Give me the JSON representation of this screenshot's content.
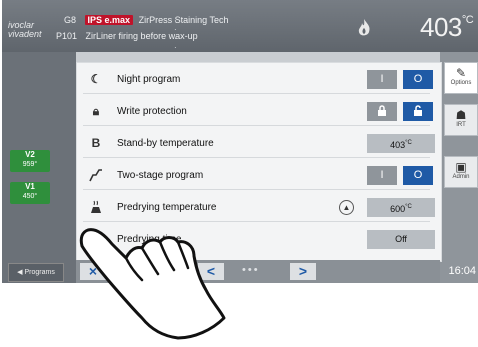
{
  "header": {
    "brand": "ivoclar vivadent",
    "code_top": "G8",
    "badge": "IPS e.max",
    "title_top": "ZirPress Staining Tech",
    "code_bottom": "P101",
    "title_bottom": "ZirLiner firing before wax-up",
    "temperature": "403",
    "temp_unit": "°C"
  },
  "settings": [
    {
      "label": "Night program",
      "icon": "moon-icon",
      "control": "toggle",
      "left": "I",
      "right": "O",
      "active": "right"
    },
    {
      "label": "Write protection",
      "icon": "lock-icon",
      "control": "toggle",
      "active": "right"
    },
    {
      "label": "Stand-by temperature",
      "icon": "letter-b-icon",
      "control": "value",
      "value": "403",
      "unit": "°C"
    },
    {
      "label": "Two-stage program",
      "icon": "two-stage-curve-icon",
      "control": "toggle",
      "left": "I",
      "right": "O",
      "active": "right"
    },
    {
      "label": "Predrying temperature",
      "icon": "predrying-icon",
      "control": "value",
      "value": "600",
      "unit": "°C"
    },
    {
      "label": "Predrying time",
      "icon": "predrying-time-icon",
      "control": "value",
      "value": "Off"
    }
  ],
  "sidebar_left": {
    "v2_label": "V2",
    "v2_value": "959°",
    "v1_label": "V1",
    "v1_value": "450°",
    "programs": "Programs"
  },
  "sidebar_right": {
    "options": "Options",
    "irt": "IRT",
    "admin": "Admin",
    "clock": "16:04"
  },
  "nav": {
    "close": "×",
    "prev": "<",
    "next": ">",
    "dots": "•••"
  },
  "colors": {
    "accent": "#1f5aa6",
    "badge": "#c0132a",
    "chip": "#2f8f3c"
  }
}
